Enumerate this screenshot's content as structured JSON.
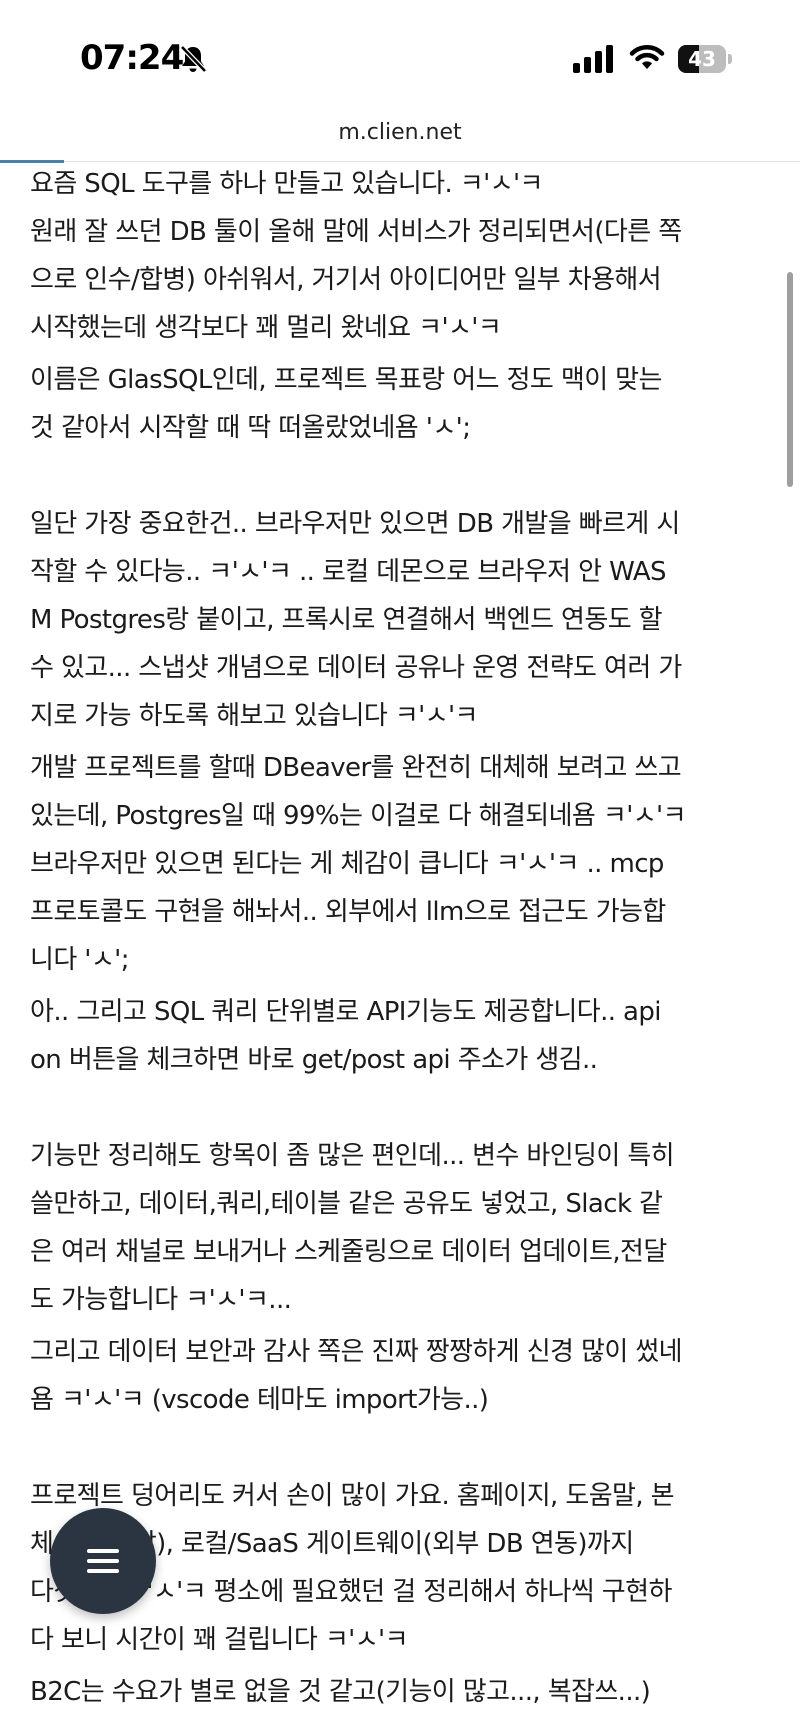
{
  "status_bar": {
    "time": "07:24",
    "battery_level": "43",
    "battery_fraction": 0.43,
    "icons": [
      "bell-slash-icon",
      "cellular-signal-icon",
      "wifi-icon",
      "battery-icon"
    ]
  },
  "browser": {
    "url": "m.clien.net",
    "page_load_progress": 0.08
  },
  "article": {
    "paragraphs": [
      [
        "요즘 SQL 도구를 하나 만들고 있습니다. ㅋ'ㅅ'ㅋ",
        "원래 잘 쓰던 DB 툴이 올해 말에 서비스가 정리되면서(다른 쪽",
        "으로 인수/합병) 아쉬워서, 거기서 아이디어만 일부 차용해서",
        "시작했는데 생각보다 꽤 멀리 왔네요 ㅋ'ㅅ'ㅋ"
      ],
      [
        "이름은 GlasSQL인데, 프로젝트 목표랑 어느 정도 맥이 맞는",
        "것 같아서 시작할 때 딱 떠올랐었네욤 'ㅅ';"
      ],
      [
        "일단 가장 중요한건.. 브라우저만 있으면 DB 개발을 빠르게 시",
        "작할 수 있다능.. ㅋ'ㅅ'ㅋ .. 로컬 데몬으로 브라우저 안 WAS",
        "M Postgres랑 붙이고, 프록시로 연결해서 백엔드 연동도 할",
        "수 있고... 스냅샷 개념으로 데이터 공유나 운영 전략도 여러 가",
        "지로 가능 하도록 해보고 있습니다 ㅋ'ㅅ'ㅋ"
      ],
      [
        "개발 프로젝트를 할때 DBeaver를 완전히 대체해 보려고 쓰고",
        "있는데, Postgres일 때 99%는 이걸로 다 해결되네욤 ㅋ'ㅅ'ㅋ",
        "브라우저만 있으면 된다는 게 체감이 큽니다 ㅋ'ㅅ'ㅋ .. mcp",
        "프로토콜도 구현을 해놔서.. 외부에서 llm으로 접근도 가능합",
        "니다 'ㅅ';"
      ],
      [
        "아.. 그리고 SQL 쿼리 단위별로 API기능도 제공합니다.. api",
        "on 버튼을 체크하면 바로 get/post api 주소가 생김.."
      ],
      [
        "기능만 정리해도 항목이 좀 많은 편인데... 변수 바인딩이 특히",
        "쓸만하고, 데이터,쿼리,테이블 같은 공유도 넣었고, Slack 같",
        "은 여러 채널로 보내거나 스케줄링으로 데이터 업데이트,전달",
        "도 가능합니다 ㅋ'ㅅ'ㅋ..."
      ],
      [
        "그리고 데이터 보안과 감사 쪽은 진짜 짱짱하게 신경 많이 썼네",
        "욤 ㅋ'ㅅ'ㅋ  (vscode 테마도 import가능..)"
      ],
      [
        "프로젝트 덩어리도 커서 손이 많이 가요. 홈페이지, 도움말, 본",
        "체(데스크탑), 로컬/SaaS 게이트웨이(외부 DB 연동)까지",
        "다섯개.. ㅋ'ㅅ'ㅋ  평소에 필요했던 걸 정리해서 하나씩 구현하",
        "다 보니 시간이 꽤 걸립니다 ㅋ'ㅅ'ㅋ"
      ],
      [
        "B2C는 수요가 별로 없을 것 같고(기능이 많고..., 복잡쓰...)"
      ]
    ]
  },
  "fab": {
    "icon": "menu-icon"
  }
}
